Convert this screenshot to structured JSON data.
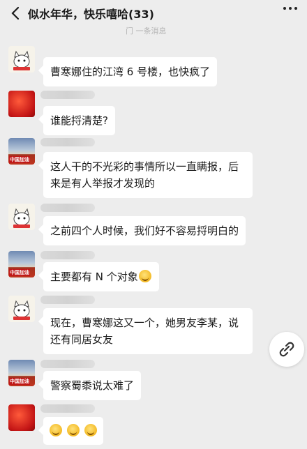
{
  "header": {
    "title": "似水年华，快乐嘻哈(33)",
    "subtitle": "门 一条消息"
  },
  "messages": [
    {
      "avatar": "cat-avatar",
      "text": "曹寒娜住的江湾 6 号楼，也快疯了"
    },
    {
      "avatar": "red-avatar",
      "text": "谁能捋清楚?"
    },
    {
      "avatar": "flag-avatar",
      "avatar_text": "中国加油",
      "lines": [
        "这人干的不光彩的事情所以一直瞒报，后",
        "来是有人举报才发现的"
      ]
    },
    {
      "avatar": "cat-avatar",
      "text": "之前四个人时候，我们好不容易捋明白的"
    },
    {
      "avatar": "flag-avatar",
      "avatar_text": "中国加油",
      "text": "主要都有 N 个对象"
    },
    {
      "avatar": "cat-avatar",
      "lines": [
        "现在，曹寒娜这又一个，她男友李某，说",
        "还有同居女友"
      ]
    },
    {
      "avatar": "flag-avatar",
      "avatar_text": "中国加油",
      "text": "警察蜀黍说太难了"
    },
    {
      "avatar": "red-avatar",
      "emojis": [
        "grin-emoji",
        "grin-emoji",
        "grin-emoji"
      ]
    }
  ],
  "colors": {
    "background": "#ededed",
    "bubble": "#ffffff"
  }
}
